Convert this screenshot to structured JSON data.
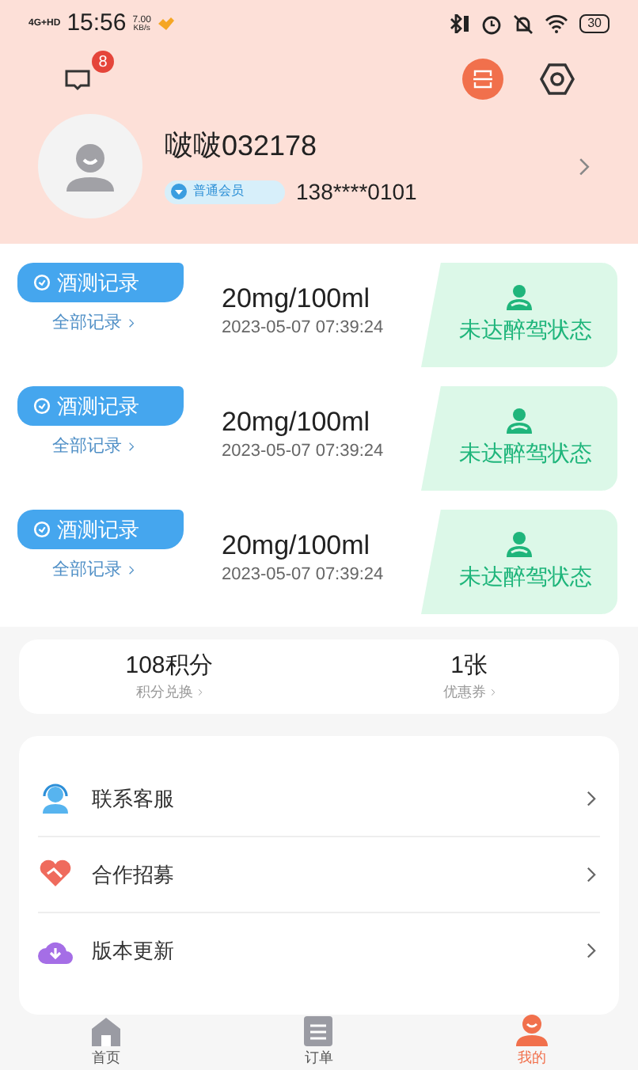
{
  "status_bar": {
    "network": "4G+HD",
    "time": "15:56",
    "speed": "7.00",
    "speed_unit": "KB/s",
    "battery": "30"
  },
  "header": {
    "message_badge": "8"
  },
  "profile": {
    "name": "啵啵032178",
    "member": "普通会员",
    "phone": "138****0101"
  },
  "records": [
    {
      "tag": "酒测记录",
      "link": "全部记录",
      "reading": "20mg/100ml",
      "datetime": "2023-05-07 07:39:24",
      "status": "未达醉驾状态"
    },
    {
      "tag": "酒测记录",
      "link": "全部记录",
      "reading": "20mg/100ml",
      "datetime": "2023-05-07 07:39:24",
      "status": "未达醉驾状态"
    },
    {
      "tag": "酒测记录",
      "link": "全部记录",
      "reading": "20mg/100ml",
      "datetime": "2023-05-07 07:39:24",
      "status": "未达醉驾状态"
    }
  ],
  "stats": [
    {
      "value": "108积分",
      "label": "积分兑换"
    },
    {
      "value": "1张",
      "label": "优惠券"
    }
  ],
  "menu": [
    {
      "kind": "service",
      "label": "联系客服"
    },
    {
      "kind": "partner",
      "label": "合作招募"
    },
    {
      "kind": "update",
      "label": "版本更新"
    }
  ],
  "tabs": [
    {
      "kind": "home",
      "label": "首页",
      "selected": false
    },
    {
      "kind": "orders",
      "label": "订单",
      "selected": false
    },
    {
      "kind": "mine",
      "label": "我的",
      "selected": true
    }
  ]
}
